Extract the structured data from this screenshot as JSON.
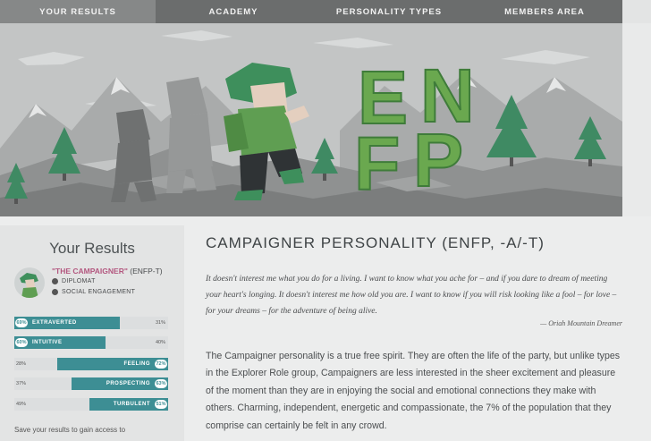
{
  "nav": {
    "items": [
      {
        "label": "YOUR RESULTS",
        "active": true
      },
      {
        "label": "ACADEMY",
        "active": false
      },
      {
        "label": "PERSONALITY TYPES",
        "active": false
      },
      {
        "label": "MEMBERS AREA",
        "active": false
      }
    ]
  },
  "hero": {
    "letters": [
      "E",
      "N",
      "F",
      "P"
    ]
  },
  "sidebar": {
    "title": "Your Results",
    "type_name": "\"THE CAMPAIGNER\"",
    "type_code": "(ENFP-T)",
    "role": "DIPLOMAT",
    "strategy": "SOCIAL ENGAGEMENT",
    "traits": [
      {
        "left_label": "EXTRAVERTED",
        "left_pct": "69%",
        "right_pct": "31%",
        "side": "left",
        "value": 0.69
      },
      {
        "left_label": "INTUITIVE",
        "left_pct": "60%",
        "right_pct": "40%",
        "side": "left",
        "value": 0.6
      },
      {
        "right_label": "FEELING",
        "left_pct": "28%",
        "right_pct": "72%",
        "side": "right",
        "value": 0.72
      },
      {
        "right_label": "PROSPECTING",
        "left_pct": "37%",
        "right_pct": "63%",
        "side": "right",
        "value": 0.63
      },
      {
        "right_label": "TURBULENT",
        "left_pct": "49%",
        "right_pct": "51%",
        "side": "right",
        "value": 0.51
      }
    ],
    "save_text": "Save your results to gain access to"
  },
  "main": {
    "title": "CAMPAIGNER PERSONALITY (ENFP, -A/-T)",
    "quote": "It doesn't interest me what you do for a living. I want to know what you ache for – and if you dare to dream of meeting your heart's longing. It doesn't interest me how old you are. I want to know if you will risk looking like a fool – for love – for your dreams – for the adventure of being alive.",
    "quote_author": "— Oriah Mountain Dreamer",
    "body": "The Campaigner personality is a true free spirit. They are often the life of the party, but unlike types in the Explorer Role group, Campaigners are less interested in the sheer excitement and pleasure of the moment than they are in enjoying the social and emotional connections they make with others. Charming, independent, energetic and compassionate, the 7% of the population that they comprise can certainly be felt in any crowd."
  },
  "colors": {
    "nav_bg": "#6b6d6d",
    "nav_active": "#868888",
    "accent_teal": "#3d8e94",
    "type_pink": "#b3577f",
    "enfp_green": "#6aa84f"
  }
}
